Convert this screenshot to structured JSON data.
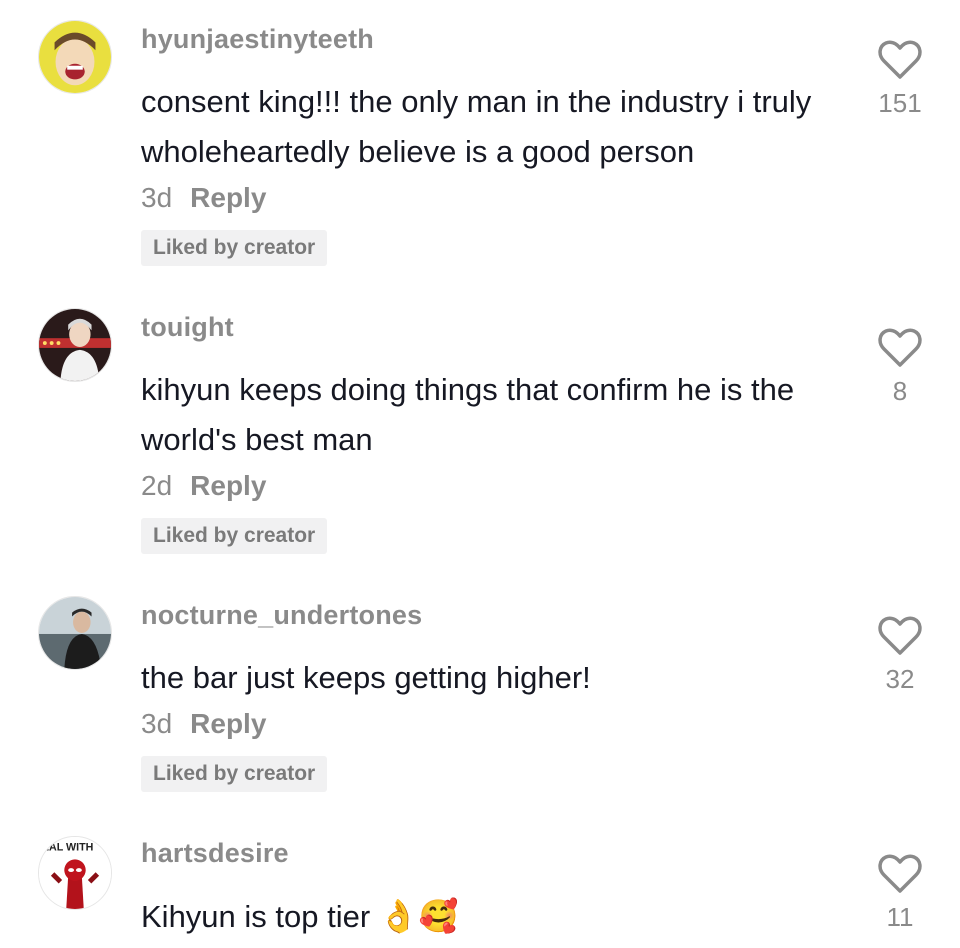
{
  "comments": [
    {
      "username": "hyunjaestinyteeth",
      "text": "consent king!!! the only man in the industry i truly wholeheartedly believe is a good person",
      "date": "3d",
      "reply_label": "Reply",
      "badge": "Liked by creator",
      "likes": "151",
      "avatar_icon": "avatar-yellow-character-icon"
    },
    {
      "username": "touight",
      "text": "kihyun keeps doing things that confirm he is the world's best man",
      "date": "2d",
      "reply_label": "Reply",
      "badge": "Liked by creator",
      "likes": "8",
      "avatar_icon": "avatar-person-stage-icon"
    },
    {
      "username": "nocturne_undertones",
      "text": "the bar just keeps getting higher!",
      "date": "3d",
      "reply_label": "Reply",
      "badge": "Liked by creator",
      "likes": "32",
      "avatar_icon": "avatar-person-coast-icon"
    },
    {
      "username": "hartsdesire",
      "text": "Kihyun is top tier",
      "emoji": "👌🥰",
      "likes": "11",
      "avatar_icon": "avatar-deadpool-meme-icon",
      "avatar_text": "EAL WITH"
    }
  ],
  "colors": {
    "text": "#161823",
    "muted": "#8a8a8a",
    "badge_bg": "#f1f1f2"
  }
}
